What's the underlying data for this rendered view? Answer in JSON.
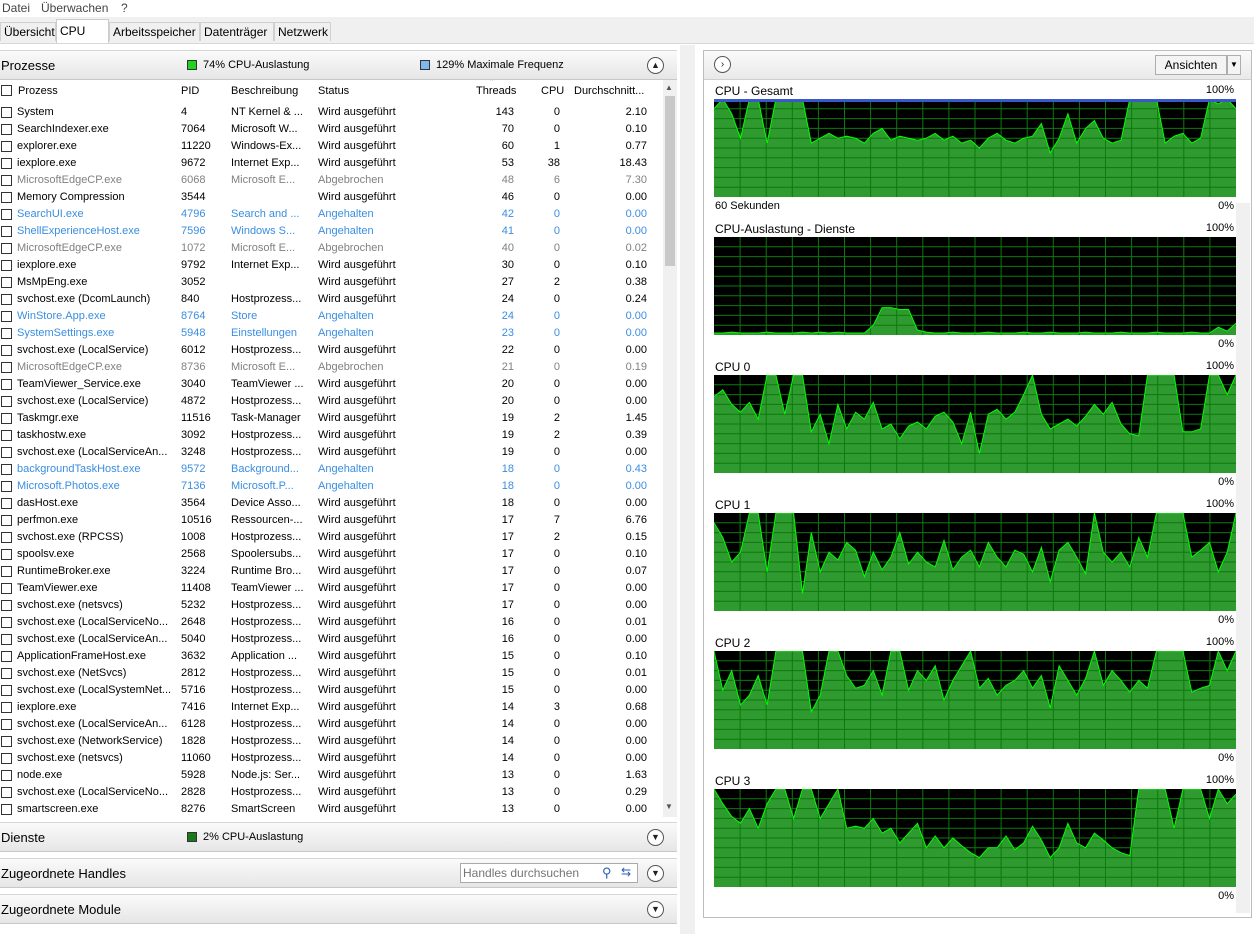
{
  "menu": {
    "file": "Datei",
    "monitor": "Überwachen",
    "help": "?"
  },
  "tabs": [
    "Übersicht",
    "CPU",
    "Arbeitsspeicher",
    "Datenträger",
    "Netzwerk"
  ],
  "processes": {
    "title": "Prozesse",
    "usage": "74% CPU-Auslastung",
    "frequency": "129% Maximale Frequenz",
    "columns": [
      "Prozess",
      "PID",
      "Beschreibung",
      "Status",
      "Threads",
      "CPU",
      "Durchschnitt..."
    ],
    "rows": [
      {
        "name": "System",
        "pid": "4",
        "desc": "NT Kernel & ...",
        "status": "Wird ausgeführt",
        "threads": "143",
        "cpu": "0",
        "avg": "2.10",
        "state": "normal"
      },
      {
        "name": "SearchIndexer.exe",
        "pid": "7064",
        "desc": "Microsoft W...",
        "status": "Wird ausgeführt",
        "threads": "70",
        "cpu": "0",
        "avg": "0.10",
        "state": "normal"
      },
      {
        "name": "explorer.exe",
        "pid": "11220",
        "desc": "Windows-Ex...",
        "status": "Wird ausgeführt",
        "threads": "60",
        "cpu": "1",
        "avg": "0.77",
        "state": "normal"
      },
      {
        "name": "iexplore.exe",
        "pid": "9672",
        "desc": "Internet Exp...",
        "status": "Wird ausgeführt",
        "threads": "53",
        "cpu": "38",
        "avg": "18.43",
        "state": "normal"
      },
      {
        "name": "MicrosoftEdgeCP.exe",
        "pid": "6068",
        "desc": "Microsoft E...",
        "status": "Abgebrochen",
        "threads": "48",
        "cpu": "6",
        "avg": "7.30",
        "state": "gray"
      },
      {
        "name": "Memory Compression",
        "pid": "3544",
        "desc": "",
        "status": "Wird ausgeführt",
        "threads": "46",
        "cpu": "0",
        "avg": "0.00",
        "state": "normal"
      },
      {
        "name": "SearchUI.exe",
        "pid": "4796",
        "desc": "Search and ...",
        "status": "Angehalten",
        "threads": "42",
        "cpu": "0",
        "avg": "0.00",
        "state": "blue"
      },
      {
        "name": "ShellExperienceHost.exe",
        "pid": "7596",
        "desc": "Windows S...",
        "status": "Angehalten",
        "threads": "41",
        "cpu": "0",
        "avg": "0.00",
        "state": "blue"
      },
      {
        "name": "MicrosoftEdgeCP.exe",
        "pid": "1072",
        "desc": "Microsoft E...",
        "status": "Abgebrochen",
        "threads": "40",
        "cpu": "0",
        "avg": "0.02",
        "state": "gray"
      },
      {
        "name": "iexplore.exe",
        "pid": "9792",
        "desc": "Internet Exp...",
        "status": "Wird ausgeführt",
        "threads": "30",
        "cpu": "0",
        "avg": "0.10",
        "state": "normal"
      },
      {
        "name": "MsMpEng.exe",
        "pid": "3052",
        "desc": "",
        "status": "Wird ausgeführt",
        "threads": "27",
        "cpu": "2",
        "avg": "0.38",
        "state": "normal"
      },
      {
        "name": "svchost.exe (DcomLaunch)",
        "pid": "840",
        "desc": "Hostprozess...",
        "status": "Wird ausgeführt",
        "threads": "24",
        "cpu": "0",
        "avg": "0.24",
        "state": "normal"
      },
      {
        "name": "WinStore.App.exe",
        "pid": "8764",
        "desc": "Store",
        "status": "Angehalten",
        "threads": "24",
        "cpu": "0",
        "avg": "0.00",
        "state": "blue"
      },
      {
        "name": "SystemSettings.exe",
        "pid": "5948",
        "desc": "Einstellungen",
        "status": "Angehalten",
        "threads": "23",
        "cpu": "0",
        "avg": "0.00",
        "state": "blue"
      },
      {
        "name": "svchost.exe (LocalService)",
        "pid": "6012",
        "desc": "Hostprozess...",
        "status": "Wird ausgeführt",
        "threads": "22",
        "cpu": "0",
        "avg": "0.00",
        "state": "normal"
      },
      {
        "name": "MicrosoftEdgeCP.exe",
        "pid": "8736",
        "desc": "Microsoft E...",
        "status": "Abgebrochen",
        "threads": "21",
        "cpu": "0",
        "avg": "0.19",
        "state": "gray"
      },
      {
        "name": "TeamViewer_Service.exe",
        "pid": "3040",
        "desc": "TeamViewer ...",
        "status": "Wird ausgeführt",
        "threads": "20",
        "cpu": "0",
        "avg": "0.00",
        "state": "normal"
      },
      {
        "name": "svchost.exe (LocalService)",
        "pid": "4872",
        "desc": "Hostprozess...",
        "status": "Wird ausgeführt",
        "threads": "20",
        "cpu": "0",
        "avg": "0.00",
        "state": "normal"
      },
      {
        "name": "Taskmgr.exe",
        "pid": "11516",
        "desc": "Task-Manager",
        "status": "Wird ausgeführt",
        "threads": "19",
        "cpu": "2",
        "avg": "1.45",
        "state": "normal"
      },
      {
        "name": "taskhostw.exe",
        "pid": "3092",
        "desc": "Hostprozess...",
        "status": "Wird ausgeführt",
        "threads": "19",
        "cpu": "2",
        "avg": "0.39",
        "state": "normal"
      },
      {
        "name": "svchost.exe (LocalServiceAn...",
        "pid": "3248",
        "desc": "Hostprozess...",
        "status": "Wird ausgeführt",
        "threads": "19",
        "cpu": "0",
        "avg": "0.00",
        "state": "normal"
      },
      {
        "name": "backgroundTaskHost.exe",
        "pid": "9572",
        "desc": "Background...",
        "status": "Angehalten",
        "threads": "18",
        "cpu": "0",
        "avg": "0.43",
        "state": "blue"
      },
      {
        "name": "Microsoft.Photos.exe",
        "pid": "7136",
        "desc": "Microsoft.P...",
        "status": "Angehalten",
        "threads": "18",
        "cpu": "0",
        "avg": "0.00",
        "state": "blue"
      },
      {
        "name": "dasHost.exe",
        "pid": "3564",
        "desc": "Device Asso...",
        "status": "Wird ausgeführt",
        "threads": "18",
        "cpu": "0",
        "avg": "0.00",
        "state": "normal"
      },
      {
        "name": "perfmon.exe",
        "pid": "10516",
        "desc": "Ressourcen-...",
        "status": "Wird ausgeführt",
        "threads": "17",
        "cpu": "7",
        "avg": "6.76",
        "state": "normal"
      },
      {
        "name": "svchost.exe (RPCSS)",
        "pid": "1008",
        "desc": "Hostprozess...",
        "status": "Wird ausgeführt",
        "threads": "17",
        "cpu": "2",
        "avg": "0.15",
        "state": "normal"
      },
      {
        "name": "spoolsv.exe",
        "pid": "2568",
        "desc": "Spoolersubs...",
        "status": "Wird ausgeführt",
        "threads": "17",
        "cpu": "0",
        "avg": "0.10",
        "state": "normal"
      },
      {
        "name": "RuntimeBroker.exe",
        "pid": "3224",
        "desc": "Runtime Bro...",
        "status": "Wird ausgeführt",
        "threads": "17",
        "cpu": "0",
        "avg": "0.07",
        "state": "normal"
      },
      {
        "name": "TeamViewer.exe",
        "pid": "11408",
        "desc": "TeamViewer ...",
        "status": "Wird ausgeführt",
        "threads": "17",
        "cpu": "0",
        "avg": "0.00",
        "state": "normal"
      },
      {
        "name": "svchost.exe (netsvcs)",
        "pid": "5232",
        "desc": "Hostprozess...",
        "status": "Wird ausgeführt",
        "threads": "17",
        "cpu": "0",
        "avg": "0.00",
        "state": "normal"
      },
      {
        "name": "svchost.exe (LocalServiceNo...",
        "pid": "2648",
        "desc": "Hostprozess...",
        "status": "Wird ausgeführt",
        "threads": "16",
        "cpu": "0",
        "avg": "0.01",
        "state": "normal"
      },
      {
        "name": "svchost.exe (LocalServiceAn...",
        "pid": "5040",
        "desc": "Hostprozess...",
        "status": "Wird ausgeführt",
        "threads": "16",
        "cpu": "0",
        "avg": "0.00",
        "state": "normal"
      },
      {
        "name": "ApplicationFrameHost.exe",
        "pid": "3632",
        "desc": "Application ...",
        "status": "Wird ausgeführt",
        "threads": "15",
        "cpu": "0",
        "avg": "0.10",
        "state": "normal"
      },
      {
        "name": "svchost.exe (NetSvcs)",
        "pid": "2812",
        "desc": "Hostprozess...",
        "status": "Wird ausgeführt",
        "threads": "15",
        "cpu": "0",
        "avg": "0.01",
        "state": "normal"
      },
      {
        "name": "svchost.exe (LocalSystemNet...",
        "pid": "5716",
        "desc": "Hostprozess...",
        "status": "Wird ausgeführt",
        "threads": "15",
        "cpu": "0",
        "avg": "0.00",
        "state": "normal"
      },
      {
        "name": "iexplore.exe",
        "pid": "7416",
        "desc": "Internet Exp...",
        "status": "Wird ausgeführt",
        "threads": "14",
        "cpu": "3",
        "avg": "0.68",
        "state": "normal"
      },
      {
        "name": "svchost.exe (LocalServiceAn...",
        "pid": "6128",
        "desc": "Hostprozess...",
        "status": "Wird ausgeführt",
        "threads": "14",
        "cpu": "0",
        "avg": "0.00",
        "state": "normal"
      },
      {
        "name": "svchost.exe (NetworkService)",
        "pid": "1828",
        "desc": "Hostprozess...",
        "status": "Wird ausgeführt",
        "threads": "14",
        "cpu": "0",
        "avg": "0.00",
        "state": "normal"
      },
      {
        "name": "svchost.exe (netsvcs)",
        "pid": "11060",
        "desc": "Hostprozess...",
        "status": "Wird ausgeführt",
        "threads": "14",
        "cpu": "0",
        "avg": "0.00",
        "state": "normal"
      },
      {
        "name": "node.exe",
        "pid": "5928",
        "desc": "Node.js: Ser...",
        "status": "Wird ausgeführt",
        "threads": "13",
        "cpu": "0",
        "avg": "1.63",
        "state": "normal"
      },
      {
        "name": "svchost.exe (LocalServiceNo...",
        "pid": "2828",
        "desc": "Hostprozess...",
        "status": "Wird ausgeführt",
        "threads": "13",
        "cpu": "0",
        "avg": "0.29",
        "state": "normal"
      },
      {
        "name": "smartscreen.exe",
        "pid": "8276",
        "desc": "SmartScreen",
        "status": "Wird ausgeführt",
        "threads": "13",
        "cpu": "0",
        "avg": "0.00",
        "state": "normal"
      }
    ]
  },
  "services": {
    "title": "Dienste",
    "usage": "2% CPU-Auslastung"
  },
  "handles": {
    "title": "Zugeordnete Handles",
    "search_placeholder": "Handles durchsuchen"
  },
  "modules": {
    "title": "Zugeordnete Module"
  },
  "views_button": "Ansichten",
  "colors": {
    "graph_bg": "#000000",
    "graph_fill": "#2f9a2f",
    "graph_line": "#00ff00",
    "grid": "#0c7a0c",
    "max_freq": "#3a58c8",
    "running": "#000000",
    "suspended": "#3a8ee0",
    "terminated": "#808080"
  },
  "graphs": [
    {
      "title": "CPU - Gesamt",
      "max": "100%",
      "min": "0%",
      "sublabel": "60 Sekunden",
      "values": [
        90,
        100,
        85,
        60,
        100,
        100,
        55,
        100,
        100,
        100,
        100,
        55,
        60,
        65,
        60,
        62,
        60,
        55,
        65,
        70,
        58,
        62,
        60,
        58,
        60,
        65,
        58,
        62,
        55,
        58,
        50,
        60,
        65,
        58,
        55,
        60,
        62,
        75,
        45,
        60,
        85,
        55,
        70,
        78,
        60,
        55,
        58,
        100,
        100,
        100,
        100,
        55,
        62,
        65,
        55,
        60,
        100,
        95,
        100,
        90
      ]
    },
    {
      "title": "CPU-Auslastung - Dienste",
      "max": "100%",
      "min": "0%",
      "sublabel": "",
      "values": [
        2,
        2,
        3,
        2,
        2,
        2,
        3,
        2,
        2,
        2,
        3,
        2,
        3,
        2,
        3,
        2,
        2,
        2,
        10,
        28,
        28,
        26,
        26,
        5,
        3,
        2,
        2,
        3,
        2,
        2,
        2,
        3,
        2,
        2,
        2,
        3,
        2,
        2,
        3,
        2,
        2,
        2,
        3,
        2,
        2,
        2,
        3,
        2,
        2,
        2,
        3,
        2,
        2,
        2,
        3,
        2,
        2,
        8,
        4,
        12
      ]
    },
    {
      "title": "CPU 0",
      "max": "100%",
      "min": "0%",
      "sublabel": "",
      "values": [
        78,
        85,
        70,
        62,
        72,
        55,
        100,
        100,
        60,
        100,
        100,
        42,
        60,
        30,
        70,
        45,
        62,
        55,
        72,
        45,
        50,
        35,
        48,
        52,
        45,
        58,
        62,
        52,
        30,
        62,
        20,
        60,
        65,
        55,
        62,
        80,
        100,
        60,
        45,
        50,
        55,
        48,
        58,
        70,
        60,
        72,
        50,
        40,
        38,
        100,
        100,
        100,
        100,
        42,
        42,
        45,
        100,
        100,
        80,
        100
      ]
    },
    {
      "title": "CPU 1",
      "max": "100%",
      "min": "0%",
      "sublabel": "",
      "values": [
        90,
        75,
        50,
        60,
        100,
        100,
        40,
        100,
        100,
        100,
        18,
        80,
        40,
        60,
        52,
        70,
        62,
        35,
        60,
        42,
        55,
        80,
        48,
        60,
        50,
        45,
        72,
        42,
        55,
        62,
        45,
        70,
        55,
        45,
        62,
        58,
        40,
        65,
        30,
        62,
        70,
        55,
        38,
        100,
        60,
        50,
        60,
        45,
        75,
        55,
        100,
        100,
        100,
        100,
        55,
        62,
        70,
        40,
        60,
        100
      ]
    },
    {
      "title": "CPU 2",
      "max": "100%",
      "min": "0%",
      "sublabel": "",
      "values": [
        100,
        60,
        80,
        45,
        55,
        75,
        45,
        100,
        100,
        100,
        100,
        38,
        55,
        100,
        100,
        75,
        62,
        65,
        80,
        55,
        100,
        100,
        60,
        80,
        70,
        85,
        50,
        70,
        85,
        100,
        62,
        72,
        55,
        65,
        70,
        80,
        62,
        75,
        42,
        85,
        70,
        55,
        72,
        100,
        65,
        80,
        70,
        58,
        70,
        62,
        100,
        100,
        100,
        100,
        58,
        62,
        65,
        100,
        80,
        100
      ]
    },
    {
      "title": "CPU 3",
      "max": "100%",
      "min": "0%",
      "sublabel": "",
      "values": [
        100,
        85,
        72,
        65,
        80,
        60,
        85,
        100,
        100,
        70,
        100,
        100,
        70,
        85,
        100,
        60,
        62,
        60,
        70,
        55,
        60,
        45,
        55,
        65,
        40,
        52,
        40,
        50,
        42,
        35,
        30,
        40,
        40,
        52,
        38,
        45,
        62,
        48,
        30,
        40,
        65,
        45,
        40,
        55,
        48,
        40,
        35,
        32,
        100,
        100,
        100,
        100,
        60,
        100,
        100,
        100,
        70,
        100,
        85,
        95
      ]
    }
  ]
}
